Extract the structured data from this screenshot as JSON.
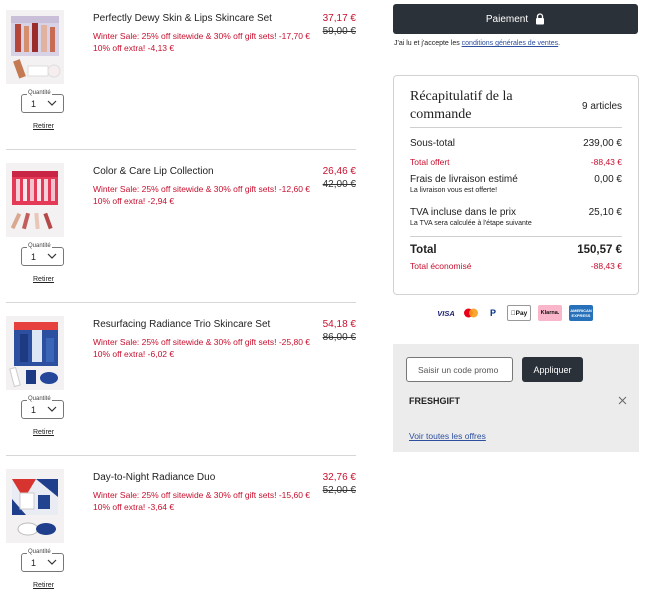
{
  "cart": {
    "qty_label": "Quantité",
    "remove_label": "Retirer",
    "items": [
      {
        "name": "Perfectly Dewy Skin & Lips Skincare Set",
        "promo_line1": "Winter Sale: 25% off sitewide & 30% off gift sets! -17,70 €",
        "promo_line2": "10% off extra! -4,13 €",
        "price": "37,17 €",
        "original_price": "59,00 €",
        "quantity": "1"
      },
      {
        "name": "Color & Care Lip Collection",
        "promo_line1": "Winter Sale: 25% off sitewide & 30% off gift sets! -12,60 €",
        "promo_line2": "10% off extra! -2,94 €",
        "price": "26,46 €",
        "original_price": "42,00 €",
        "quantity": "1"
      },
      {
        "name": "Resurfacing Radiance Trio Skincare Set",
        "promo_line1": "Winter Sale: 25% off sitewide & 30% off gift sets! -25,80 €",
        "promo_line2": "10% off extra! -6,02 €",
        "price": "54,18 €",
        "original_price": "86,00 €",
        "quantity": "1"
      },
      {
        "name": "Day-to-Night Radiance Duo",
        "promo_line1": "Winter Sale: 25% off sitewide & 30% off gift sets! -15,60 €",
        "promo_line2": "10% off extra! -3,64 €",
        "price": "32,76 €",
        "original_price": "52,00 €",
        "quantity": "1"
      }
    ]
  },
  "checkout": {
    "pay_label": "Paiement",
    "terms_prefix": "J'ai lu et j'accepte les ",
    "terms_link": "conditions générales de ventes",
    "terms_suffix": "."
  },
  "summary": {
    "title": "Récapitulatif de la commande",
    "count": "9 articles",
    "subtotal_label": "Sous-total",
    "subtotal_value": "239,00 €",
    "discount_label": "Total offert",
    "discount_value": "-88,43 €",
    "shipping_label": "Frais de livraison estimé",
    "shipping_value": "0,00 €",
    "shipping_note": "La livraison vous est offerte!",
    "tax_label": "TVA incluse dans le prix",
    "tax_value": "25,10 €",
    "tax_note": "La TVA sera calculée à l'étape suivante",
    "total_label": "Total",
    "total_value": "150,57 €",
    "saved_label": "Total économisé",
    "saved_value": "-88,43 €"
  },
  "payment_methods": {
    "visa": "VISA",
    "paypal": "P",
    "applepay": "Pay",
    "klarna": "Klarna.",
    "amex": "AMERICAN EXPRESS"
  },
  "promo": {
    "placeholder": "Saisir un code promo",
    "apply_label": "Appliquer",
    "applied_code": "FRESHGIFT",
    "offers_link": "Voir toutes les offres"
  },
  "colors": {
    "accent_red": "#c8102e",
    "button_dark": "#2b3138",
    "link_blue": "#2c4f9e"
  }
}
